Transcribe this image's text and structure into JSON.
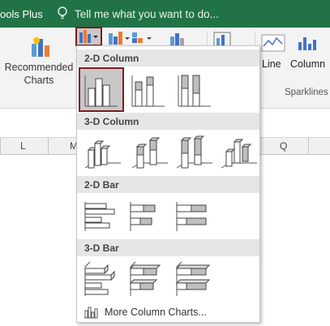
{
  "titlebar": {
    "tools_tab": "ools Plus",
    "tell_me": "Tell me what you want to do..."
  },
  "ribbon": {
    "recommended_line1": "Recommended",
    "recommended_line2": "Charts",
    "line_label": "Line",
    "column_label": "Column",
    "sparklines_label": "Sparklines"
  },
  "columns": {
    "l": "L",
    "m": "M",
    "q": "Q"
  },
  "dropdown": {
    "sections": {
      "col2d": "2-D Column",
      "col3d": "3-D Column",
      "bar2d": "2-D Bar",
      "bar3d": "3-D Bar"
    },
    "more": "More Column Charts..."
  },
  "colors": {
    "title_bar": "#217346",
    "selected_border": "#7a1c1c",
    "section_bg": "#e6e6e6"
  }
}
